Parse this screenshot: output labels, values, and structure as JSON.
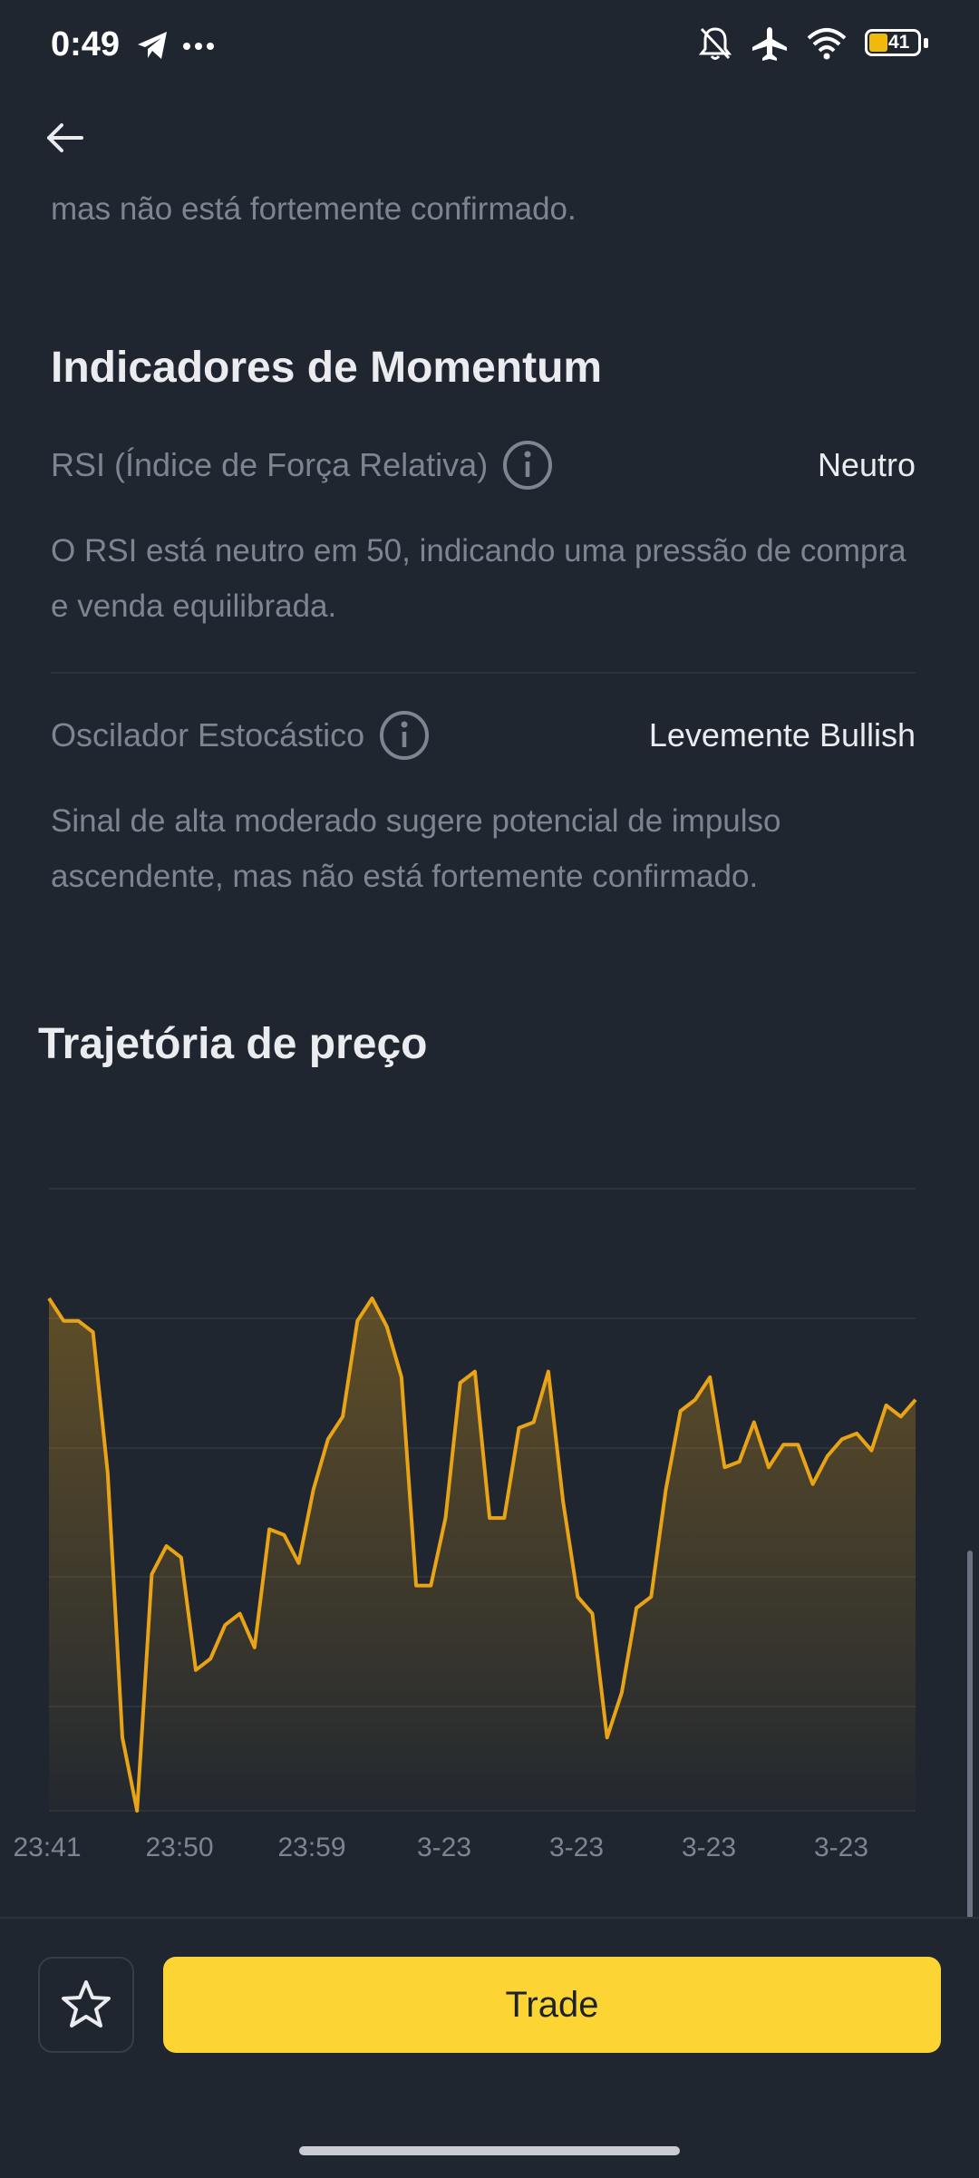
{
  "status_bar": {
    "time": "0:49",
    "battery_level": "41",
    "icons": [
      "telegram-icon",
      "more-dots-icon",
      "mute-bell-icon",
      "airplane-icon",
      "wifi-icon",
      "battery-icon"
    ]
  },
  "header": {
    "back_icon": "arrow-left-icon"
  },
  "intro_text": "mas não está fortemente confirmado.",
  "momentum": {
    "title": "Indicadores de Momentum",
    "indicators": [
      {
        "name": "RSI (Índice de Força Relativa)",
        "value": "Neutro",
        "description": "O RSI está neutro em 50, indicando uma pressão de compra e venda equilibrada."
      },
      {
        "name": "Oscilador Estocástico",
        "value": "Levemente Bullish",
        "description": "Sinal de alta moderado sugere potencial de impulso ascendente, mas não está fortemente confirmado."
      }
    ]
  },
  "price_chart": {
    "title": "Trajetória de preço"
  },
  "chart_data": {
    "type": "area",
    "x_tick_labels": [
      "23:41",
      "23:50",
      "23:59",
      "3-23",
      "3-23",
      "3-23",
      "3-23"
    ],
    "y_axis_labels_visible": false,
    "grid": "horizontal",
    "ylim": [
      0,
      100
    ],
    "values": [
      91,
      87,
      87,
      85,
      60,
      13,
      0,
      42,
      47,
      45,
      25,
      27,
      33,
      35,
      29,
      50,
      49,
      44,
      57,
      66,
      70,
      87,
      91,
      86,
      77,
      40,
      40,
      52,
      76,
      78,
      52,
      52,
      68,
      69,
      78,
      55,
      38,
      35,
      13,
      21,
      36,
      38,
      57,
      71,
      73,
      77,
      61,
      62,
      69,
      61,
      65,
      65,
      58,
      63,
      66,
      67,
      64,
      72,
      70,
      73
    ],
    "line_color": "#e8a317",
    "fill_color": "#e8a317"
  },
  "actions": {
    "favorite_icon": "star-icon",
    "trade_label": "Trade"
  }
}
